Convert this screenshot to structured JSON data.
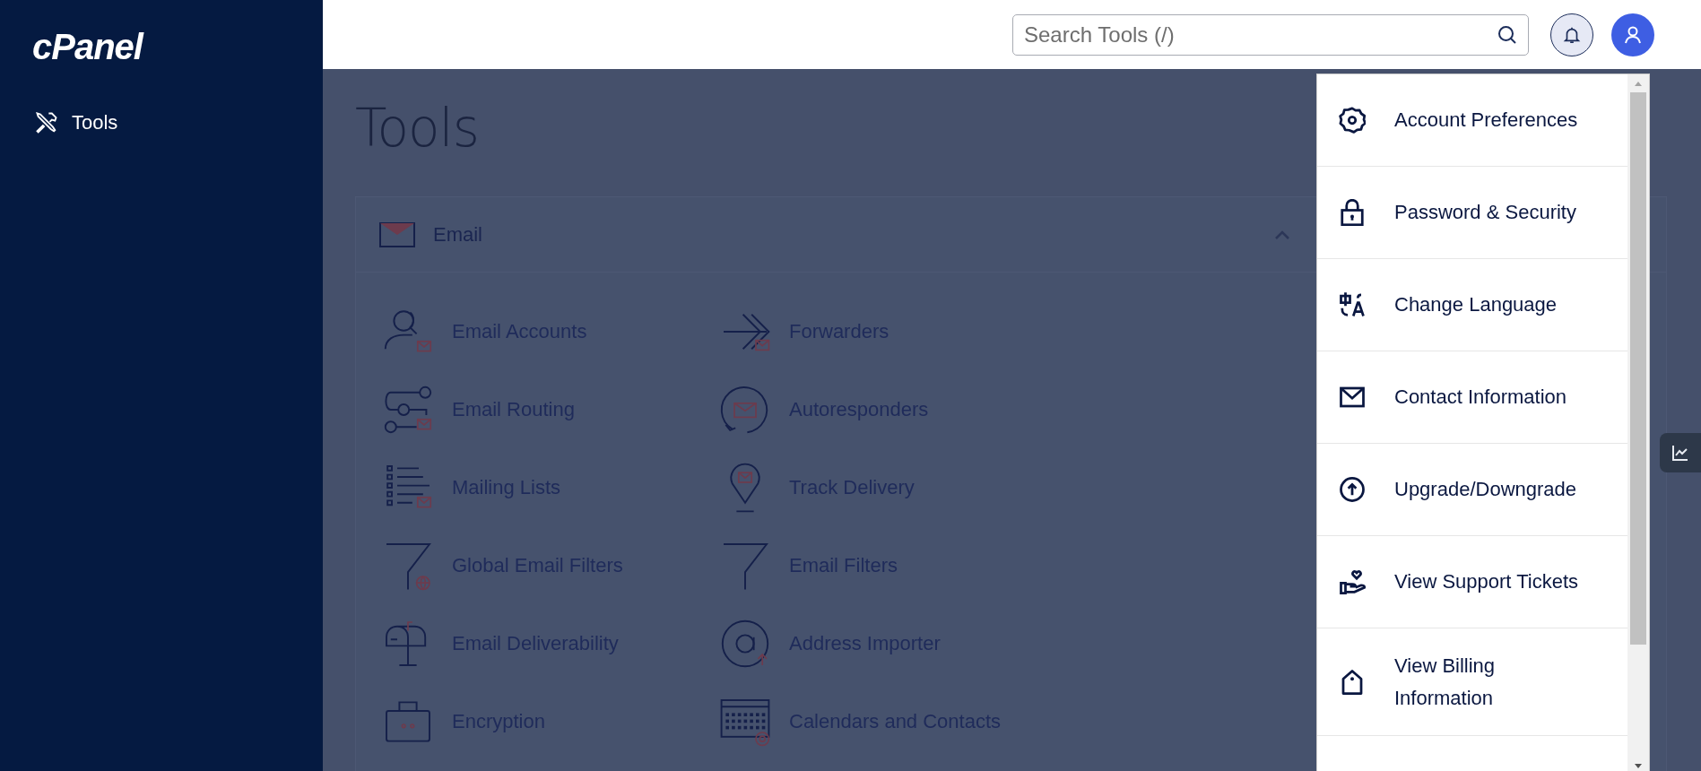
{
  "sidebar": {
    "logo": "cPanel",
    "items": [
      {
        "label": "Tools"
      }
    ]
  },
  "header": {
    "search": {
      "placeholder": "Search Tools (/)"
    }
  },
  "page_title": "Tools",
  "sections": [
    {
      "title": "Email",
      "expanded": true,
      "tools": [
        {
          "label": "Email Accounts"
        },
        {
          "label": "Forwarders"
        },
        {
          "label": "Email Routing"
        },
        {
          "label": "Autoresponders"
        },
        {
          "label": "Mailing Lists"
        },
        {
          "label": "Track Delivery"
        },
        {
          "label": "Global Email Filters"
        },
        {
          "label": "Email Filters"
        },
        {
          "label": "Email Deliverability"
        },
        {
          "label": "Address Importer"
        },
        {
          "label": "Encryption"
        },
        {
          "label": "Calendars and Contacts"
        }
      ]
    }
  ],
  "user_menu": {
    "items": [
      {
        "label": "Account Preferences"
      },
      {
        "label": "Password & Security"
      },
      {
        "label": "Change Language"
      },
      {
        "label": "Contact Information"
      },
      {
        "label": "Upgrade/Downgrade"
      },
      {
        "label": "View Support Tickets"
      },
      {
        "label": "View Billing Information"
      }
    ]
  }
}
